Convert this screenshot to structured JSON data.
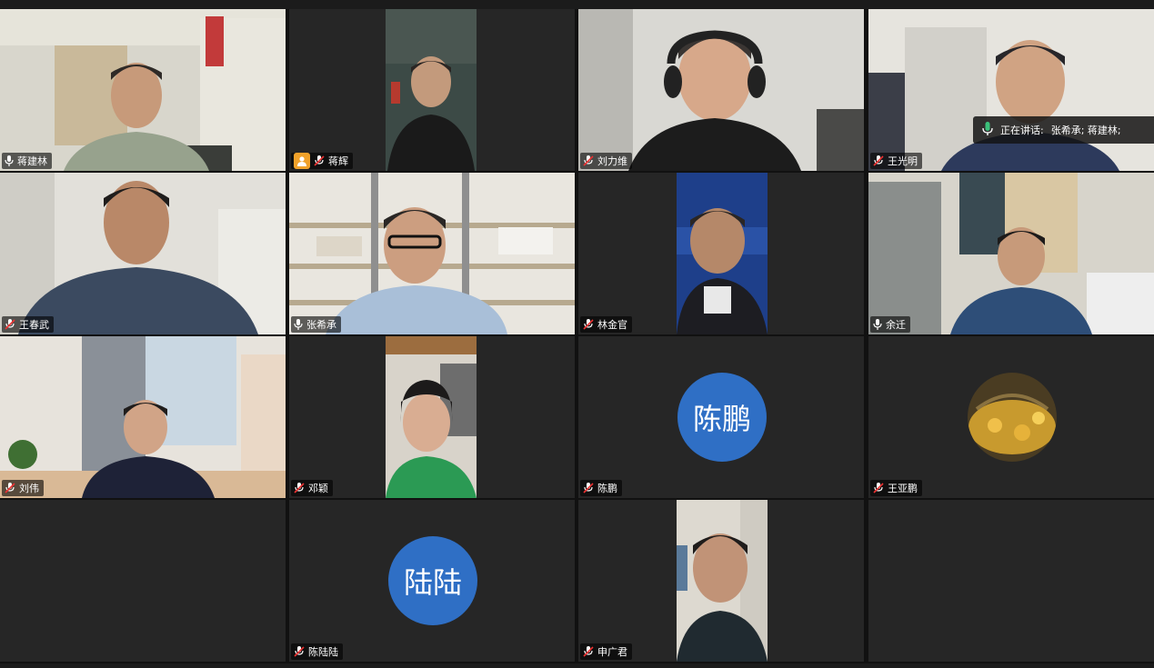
{
  "participants": [
    {
      "name": "蒋建林",
      "mic": "on"
    },
    {
      "name": "蒋辉",
      "mic": "muted",
      "host": true
    },
    {
      "name": "刘力维",
      "mic": "muted"
    },
    {
      "name": "王光明",
      "mic": "muted"
    },
    {
      "name": "王春武",
      "mic": "muted"
    },
    {
      "name": "张希承",
      "mic": "on"
    },
    {
      "name": "林金官",
      "mic": "muted"
    },
    {
      "name": "余迁",
      "mic": "on"
    },
    {
      "name": "刘伟",
      "mic": "muted"
    },
    {
      "name": "邓颖",
      "mic": "muted"
    },
    {
      "name": "陈鹏",
      "mic": "muted",
      "avatar_text": "陈鹏"
    },
    {
      "name": "王亚鹏",
      "mic": "muted"
    },
    {
      "name": "陈陆陆",
      "mic": "muted",
      "avatar_text": "陆陆"
    },
    {
      "name": "申广君",
      "mic": "muted"
    }
  ],
  "speaking": {
    "label": "正在讲话:",
    "names": "张希承; 蒋建林;"
  },
  "colors": {
    "active_border": "#33c07a",
    "avatar_blue": "#2f6fc5",
    "host_badge": "#f0a12a",
    "mic_active": "#3bc17b"
  }
}
